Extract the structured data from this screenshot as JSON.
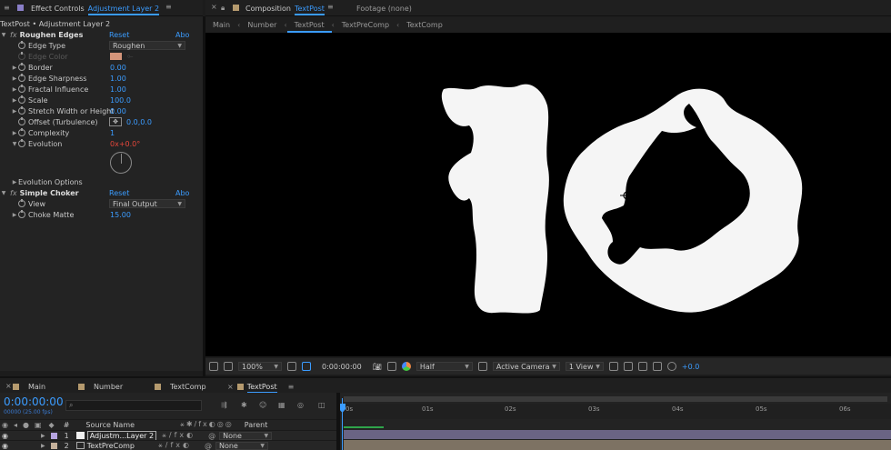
{
  "effect_controls": {
    "tab_label": "Effect Controls",
    "tab_layer": "Adjustment Layer 2",
    "subtitle": "TextPost • Adjustment Layer 2",
    "effects": [
      {
        "name": "Roughen Edges",
        "reset": "Reset",
        "about": "Abo"
      },
      {
        "name": "Simple Choker",
        "reset": "Reset",
        "about": "Abo"
      }
    ],
    "roughen": {
      "edge_type_label": "Edge Type",
      "edge_type_value": "Roughen",
      "edge_color_label": "Edge Color",
      "border_label": "Border",
      "border_value": "0.00",
      "edge_sharpness_label": "Edge Sharpness",
      "edge_sharpness_value": "1.00",
      "fractal_label": "Fractal Influence",
      "fractal_value": "1.00",
      "scale_label": "Scale",
      "scale_value": "100.0",
      "stretch_label": "Stretch Width or Height",
      "stretch_value": "0.00",
      "offset_label": "Offset (Turbulence)",
      "offset_value": "0.0,0.0",
      "complexity_label": "Complexity",
      "complexity_value": "1",
      "evolution_label": "Evolution",
      "evolution_revs": "0x",
      "evolution_deg": "+0.0°",
      "evolution_options_label": "Evolution Options"
    },
    "choker": {
      "view_label": "View",
      "view_value": "Final Output",
      "choke_label": "Choke Matte",
      "choke_value": "15.00"
    },
    "edge_color": "#d4957a"
  },
  "composition": {
    "tab_label": "Composition",
    "tab_comp": "TextPost",
    "footage_label": "Footage (none)",
    "breadcrumbs": [
      "Main",
      "Number",
      "TextPost",
      "TextPreComp",
      "TextComp"
    ],
    "active_breadcrumb": "TextPost"
  },
  "viewer_toolbar": {
    "zoom": "100%",
    "timecode": "0:00:00:00",
    "resolution": "Half",
    "camera": "Active Camera",
    "views": "1 View",
    "exposure": "+0.0"
  },
  "timeline": {
    "tabs": [
      "Main",
      "Number",
      "TextComp",
      "TextPost"
    ],
    "active_tab": "TextPost",
    "timecode": "0:00:00:00",
    "frame_info": "00000 (25.00 fps)",
    "search_placeholder": "",
    "col_hash": "#",
    "col_source": "Source Name",
    "col_parent": "Parent",
    "layers": [
      {
        "num": "1",
        "name": "Adjustm...Layer 2",
        "parent": "None",
        "color": "#b6a4e0"
      },
      {
        "num": "2",
        "name": "TextPreComp",
        "parent": "None",
        "color": "#c4b09a"
      }
    ],
    "ruler": [
      "0s",
      "01s",
      "02s",
      "03s",
      "04s",
      "05s",
      "06s"
    ]
  },
  "colors": {
    "accent": "#3b9cff",
    "tab_swatch_purple": "#8a7fc8",
    "tab_swatch_tan": "#b59a6e"
  }
}
